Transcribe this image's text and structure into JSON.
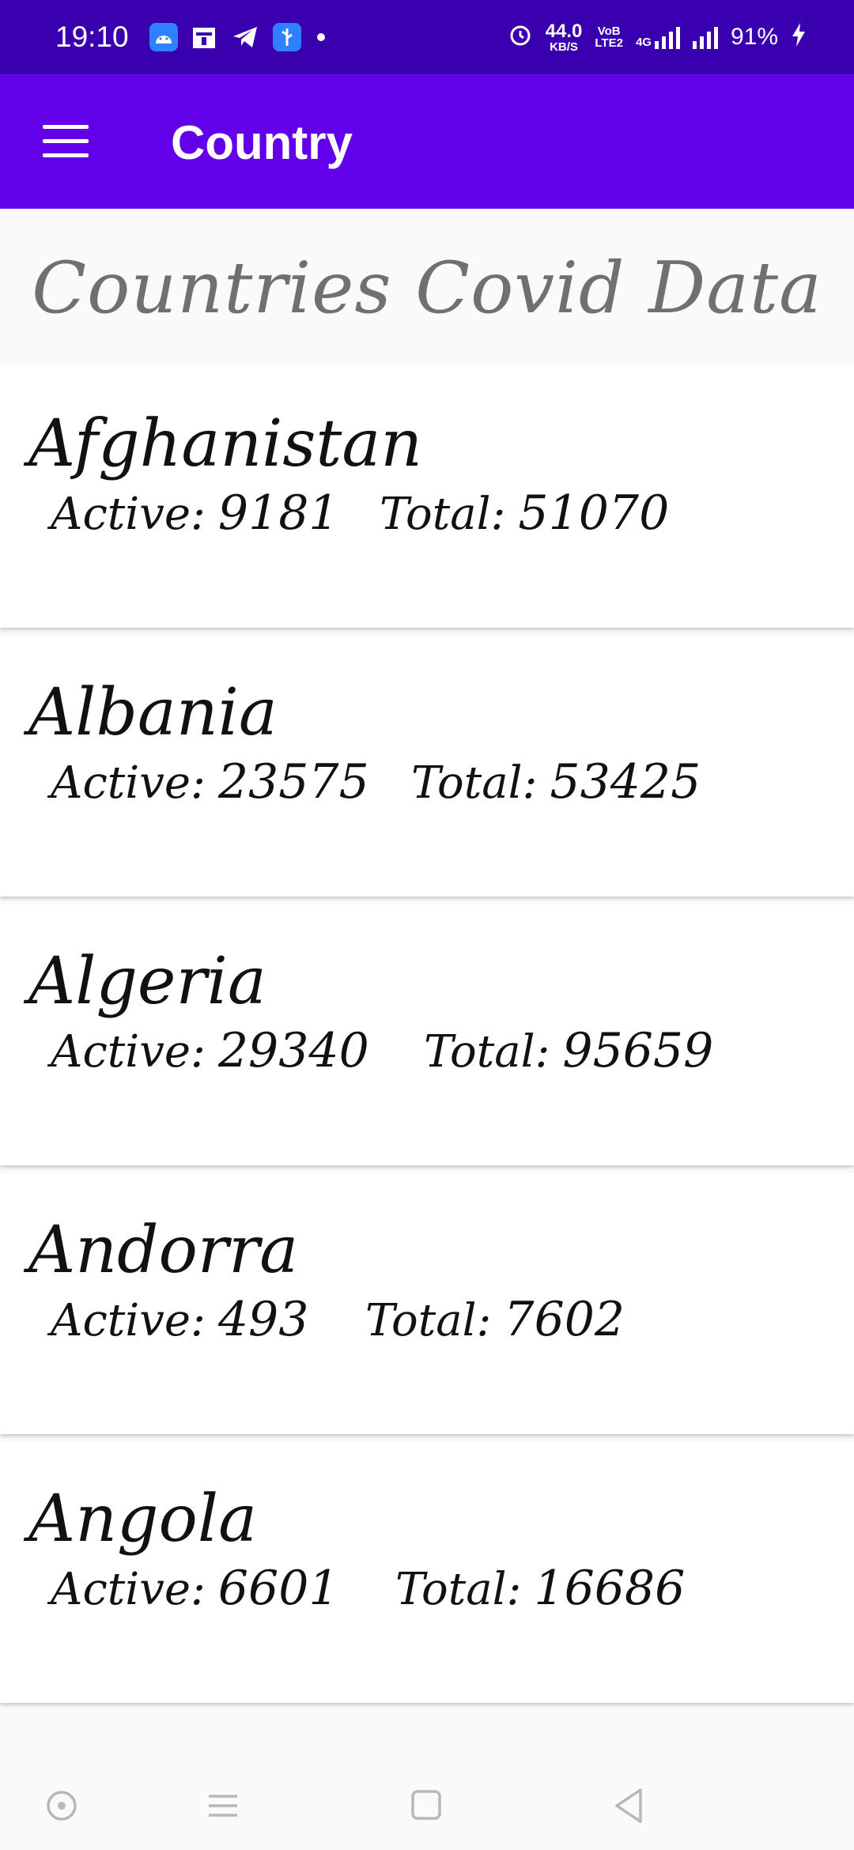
{
  "status_bar": {
    "time": "19:10",
    "speed_value": "44.0",
    "speed_unit": "KB/S",
    "vo_label": "VoB",
    "lte_label": "LTE2",
    "net_label": "4G",
    "battery": "91%",
    "icons": [
      "android-icon",
      "calendar-icon",
      "telegram-icon",
      "usb-icon",
      "alarm-icon",
      "signal-icon",
      "charging-icon"
    ]
  },
  "app_bar": {
    "title": "Country",
    "menu_icon": "hamburger-menu-icon",
    "background": "#6200ea"
  },
  "page_heading": "Countries Covid Data",
  "labels": {
    "active": "Active:",
    "total": "Total:"
  },
  "countries": [
    {
      "name": "Afghanistan",
      "active": "9181",
      "total": "51070"
    },
    {
      "name": "Albania",
      "active": "23575",
      "total": "53425"
    },
    {
      "name": "Algeria",
      "active": "29340",
      "total": "95659"
    },
    {
      "name": "Andorra",
      "active": "493",
      "total": "7602"
    },
    {
      "name": "Angola",
      "active": "6601",
      "total": "16686"
    }
  ],
  "nav_bar": {
    "buttons": [
      "assistant-icon",
      "recents-icon",
      "home-icon",
      "back-icon"
    ]
  },
  "colors": {
    "status_bar": "#3a00b0",
    "app_bar": "#6200ea",
    "heading_text": "#707070",
    "card_text": "#111111"
  }
}
